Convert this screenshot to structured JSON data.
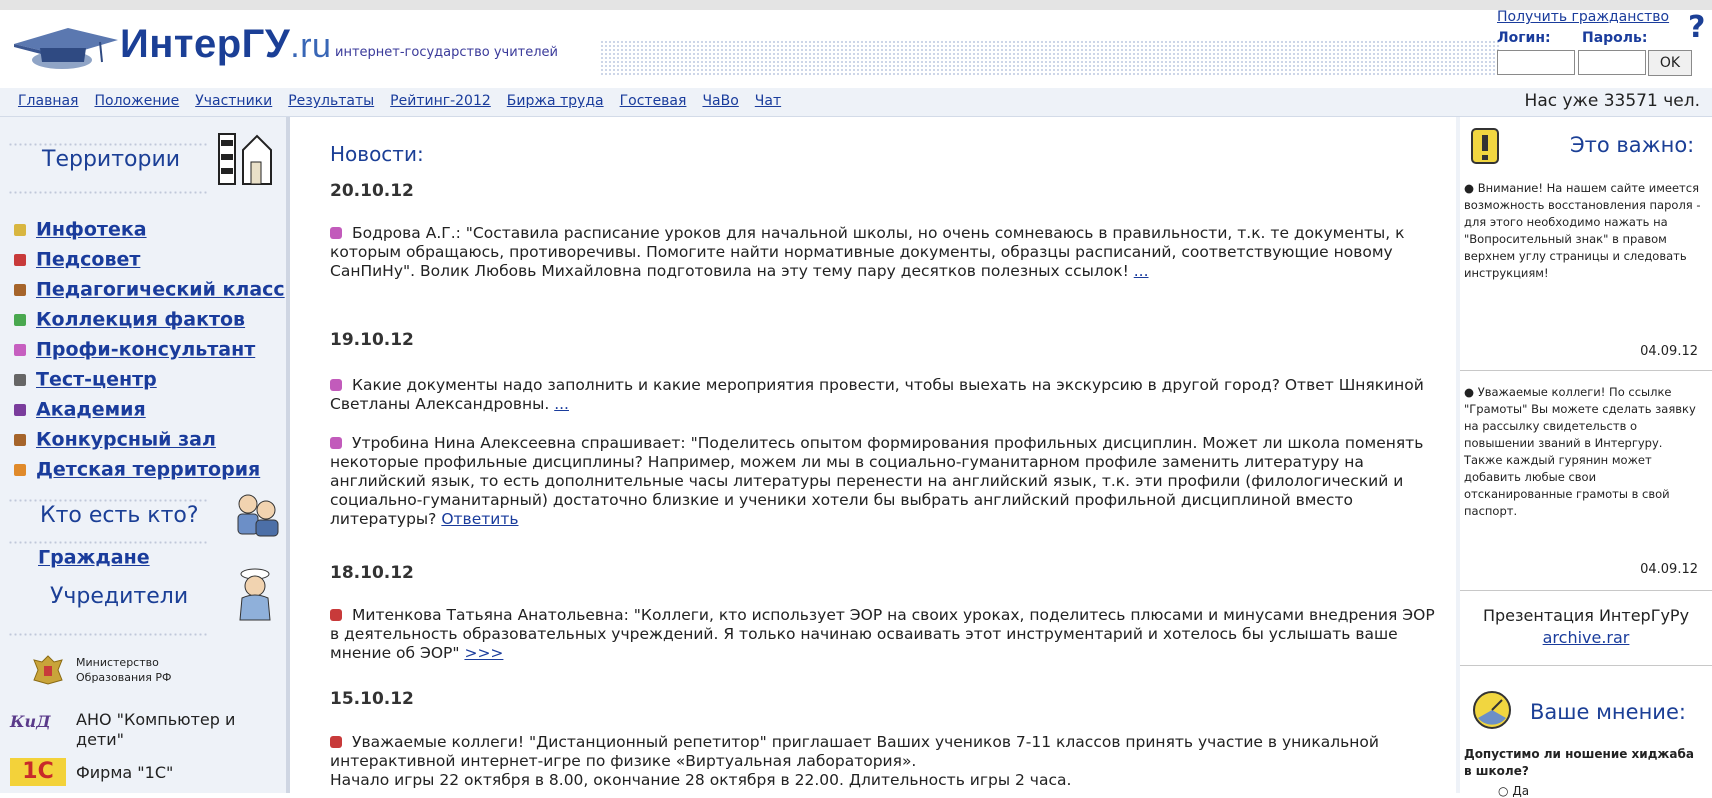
{
  "header": {
    "logo_main": "ИнтерГУ",
    "logo_suffix": ".ru",
    "tagline": "интернет-государство учителей",
    "citizen_link": "Получить гражданство",
    "login_label": "Логин:",
    "password_label": "Пароль:",
    "ok_label": "OK",
    "help_icon": "?"
  },
  "nav": {
    "items": [
      "Главная",
      "Положение",
      "Участники",
      "Результаты",
      "Рейтинг-2012",
      "Биржа труда",
      "Гостевая",
      "ЧаВо",
      "Чат"
    ],
    "member_count": "Нас уже 33571 чел."
  },
  "left": {
    "territories_title": "Территории",
    "menu": [
      {
        "label": "Инфотека",
        "color": "#d8b640"
      },
      {
        "label": "Педсовет",
        "color": "#c83a3a"
      },
      {
        "label": "Педагогический класс",
        "color": "#a5642a"
      },
      {
        "label": "Коллекция фактов",
        "color": "#49a84f"
      },
      {
        "label": "Профи-консультант",
        "color": "#c65fc0"
      },
      {
        "label": "Тест-центр",
        "color": "#666666"
      },
      {
        "label": "Академия",
        "color": "#7a3c9c"
      },
      {
        "label": "Конкурсный зал",
        "color": "#a5642a"
      },
      {
        "label": "Детская территория",
        "color": "#e08a2a"
      }
    ],
    "who_title": "Кто есть кто?",
    "citizens_link": "Граждане",
    "founders_title": "Учредители",
    "sponsors": [
      "Министерство Образования РФ",
      "АНО \"Компьютер и дети\"",
      "Фирма \"1С\""
    ],
    "kid_logo": "КиД",
    "onec_logo": "1С"
  },
  "main": {
    "news_title": "Новости:",
    "groups": [
      {
        "date": "20.10.12",
        "items": [
          {
            "color": "#c25bbb",
            "text": "Бодрова А.Г.: \"Составила расписание уроков для начальной школы, но очень сомневаюсь в правильности, т.к. те документы, к которым обращаюсь, противоречивы. Помогите найти нормативные документы, образцы расписаний, соответствующие новому СанПиНу\". Волик Любовь Михайловна подготовила на эту тему пару десятков полезных ссылок!",
            "link": "..."
          }
        ]
      },
      {
        "date": "19.10.12",
        "items": [
          {
            "color": "#c25bbb",
            "text": "Какие документы надо заполнить и какие мероприятия провести, чтобы выехать на экскурсию в другой город? Ответ Шнякиной Светланы Александровны.",
            "link": "..."
          },
          {
            "color": "#c25bbb",
            "text": "Утробина Нина Алексеевна спрашивает: \"Поделитесь опытом формирования профильных дисциплин. Может ли школа поменять некоторые профильные дисциплины? Например, можем ли мы в социально-гуманитарном профиле заменить литературу на английский язык, то есть дополнительные часы литературы перенести на английский язык, т.к. эти профили (филологический и социально-гуманитарный) достаточно близкие и ученики хотели бы выбрать английский профильной дисциплиной вместо литературы?",
            "link": "Ответить"
          }
        ]
      },
      {
        "date": "18.10.12",
        "items": [
          {
            "color": "#c83a3a",
            "text": "Митенкова Татьяна Анатольевна: \"Коллеги, кто использует ЭОР на своих уроках, поделитесь плюсами и минусами внедрения ЭОР в деятельность образовательных учреждений. Я только начинаю осваивать этот инструментарий и хотелось бы услышать ваше мнение об ЭОР\"",
            "link": ">>>"
          }
        ]
      },
      {
        "date": "15.10.12",
        "items": [
          {
            "color": "#c83a3a",
            "text": "Уважаемые коллеги! \"Дистанционный репетитор\" приглашает Ваших учеников 7-11 классов принять участие в уникальной интерактивной интернет-игре по физике «Виртуальная лаборатория».",
            "extra": "Начало игры 22 октября в 8.00, окончание 28 октября в 22.00. Длительность игры 2 часа.",
            "link": ""
          }
        ]
      }
    ]
  },
  "right": {
    "important_title": "Это важно:",
    "notices": [
      {
        "text": "Внимание! На нашем сайте имеется возможность восстановления пароля - для этого необходимо нажать на \"Вопросительный знак\" в правом верхнем углу страницы и следовать инструкциям!",
        "date": "04.09.12"
      },
      {
        "text": "Уважаемые коллеги! По ссылке \"Грамоты\" Вы можете сделать заявку на рассылку свидетельств о повышении званий в Интергуру. Также каждый гурянин может добавить любые свои отсканированные грамоты в свой паспорт.",
        "date": "04.09.12"
      }
    ],
    "presentation_label": "Презентация ИнтерГуРу",
    "presentation_link": "archive.rar",
    "opinion_title": "Ваше мнение:",
    "poll_question": "Допустимо ли ношение хиджаба в школе?",
    "poll_option": "Да"
  }
}
